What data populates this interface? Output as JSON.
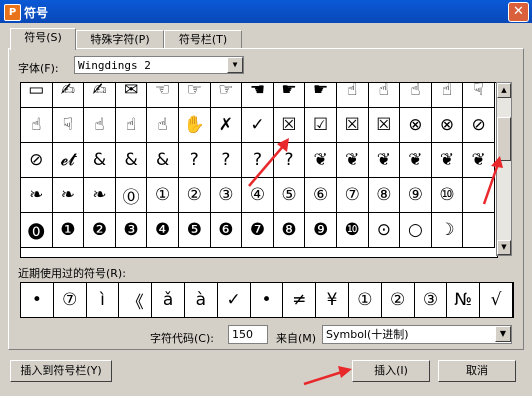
{
  "window": {
    "title": "符号",
    "app_icon_letter": "P",
    "close_glyph": "✕"
  },
  "tabs": [
    {
      "label": "符号(S)"
    },
    {
      "label": "特殊字符(P)"
    },
    {
      "label": "符号栏(T)"
    }
  ],
  "font": {
    "label": "字体(F):",
    "value": "Wingdings 2"
  },
  "grid": {
    "rows": [
      [
        "▭",
        "✍",
        "✍",
        "✉",
        "☜",
        "☞",
        "☞",
        "☚",
        "☛",
        "☛",
        "☝",
        "☝",
        "☝",
        "☝",
        "☟"
      ],
      [
        "☝",
        "☟",
        "☝",
        "☝",
        "☝",
        "✋",
        "✗",
        "✓",
        "☒",
        "☑",
        "☒",
        "☒",
        "⊗",
        "⊗",
        "⊘"
      ],
      [
        "⊘",
        "𝓮𝓽",
        "&",
        "&",
        "&",
        "?",
        "?",
        "?",
        "?",
        "❦",
        "❦",
        "❦",
        "❦",
        "❦",
        "❦"
      ],
      [
        "❧",
        "❧",
        "❧",
        "⓪",
        "①",
        "②",
        "③",
        "④",
        "⑤",
        "⑥",
        "⑦",
        "⑧",
        "⑨",
        "⑩",
        ""
      ],
      [
        "⓿",
        "❶",
        "❷",
        "❸",
        "❹",
        "❺",
        "❻",
        "❼",
        "❽",
        "❾",
        "❿",
        "⊙",
        "○",
        "☽",
        ""
      ]
    ]
  },
  "recent": {
    "label": "近期使用过的符号(R):",
    "symbols": [
      "•",
      "⑦",
      "ì",
      "《",
      "ǎ",
      "à",
      "✓",
      "•",
      "≠",
      "¥",
      "①",
      "②",
      "③",
      "№",
      "√"
    ]
  },
  "code": {
    "label": "字符代码(C):",
    "value": "150"
  },
  "from": {
    "label": "来自(M)",
    "value": "Symbol(十进制)"
  },
  "buttons": {
    "insert_to_bar": "插入到符号栏(Y)",
    "insert": "插入(I)",
    "cancel": "取消"
  }
}
